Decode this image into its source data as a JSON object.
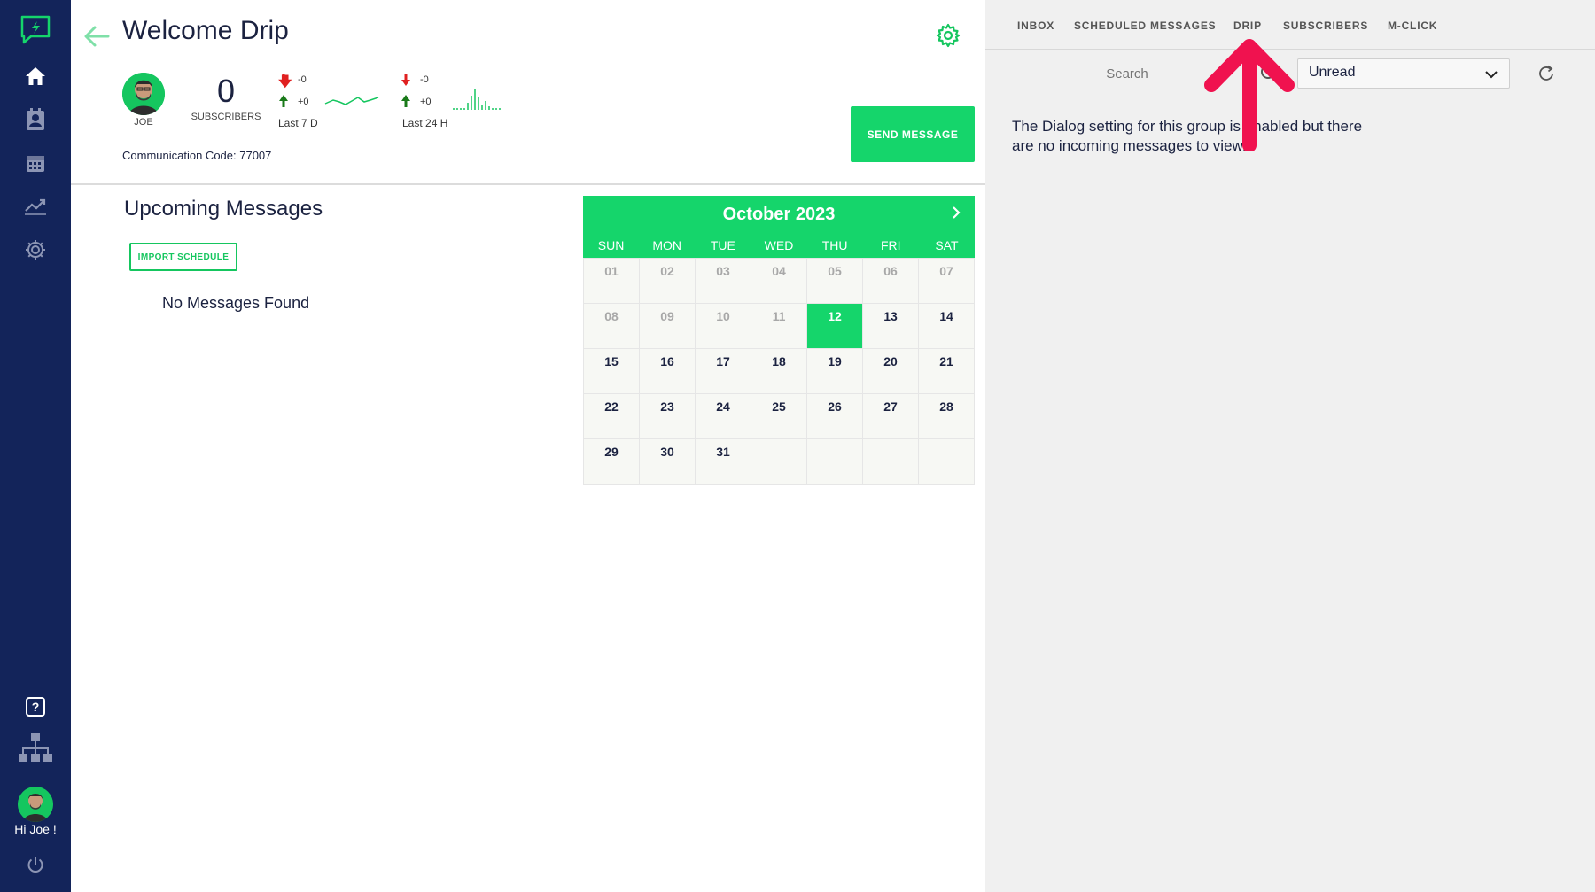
{
  "sidebar": {
    "greeting": "Hi Joe !",
    "icons": [
      "chat-logo-icon",
      "home-icon",
      "contacts-icon",
      "calendar-icon",
      "analytics-icon",
      "settings-icon",
      "help-icon",
      "org-chart-icon",
      "power-icon"
    ]
  },
  "header": {
    "title": "Welcome Drip",
    "avatar_label": "JOE",
    "subscriber_count": "0",
    "subscriber_label": "SUBSCRIBERS",
    "stats_7d": {
      "down": "-0",
      "up": "+0",
      "label": "Last 7 D"
    },
    "stats_24h": {
      "down": "-0",
      "up": "+0",
      "label": "Last 24 H"
    },
    "communication_code": "Communication Code: 77007",
    "send_button": "SEND MESSAGE"
  },
  "upcoming": {
    "title": "Upcoming Messages",
    "import_button": "IMPORT SCHEDULE",
    "empty_text": "No Messages Found"
  },
  "calendar": {
    "month_label": "October 2023",
    "weekdays": [
      "SUN",
      "MON",
      "TUE",
      "WED",
      "THU",
      "FRI",
      "SAT"
    ],
    "days": [
      "01",
      "02",
      "03",
      "04",
      "05",
      "06",
      "07",
      "08",
      "09",
      "10",
      "11",
      "12",
      "13",
      "14",
      "15",
      "16",
      "17",
      "18",
      "19",
      "20",
      "21",
      "22",
      "23",
      "24",
      "25",
      "26",
      "27",
      "28",
      "29",
      "30",
      "31"
    ],
    "today": "12"
  },
  "right_panel": {
    "tabs": [
      "INBOX",
      "SCHEDULED MESSAGES",
      "DRIP",
      "SUBSCRIBERS",
      "M-CLICK"
    ],
    "search_placeholder": "Search",
    "filter_value": "Unread",
    "message": "The Dialog setting for this group is enabled but there are no incoming messages to view."
  },
  "colors": {
    "sidebar": "#13245a",
    "accent": "#15d56b",
    "annotation": "#f0124f"
  }
}
